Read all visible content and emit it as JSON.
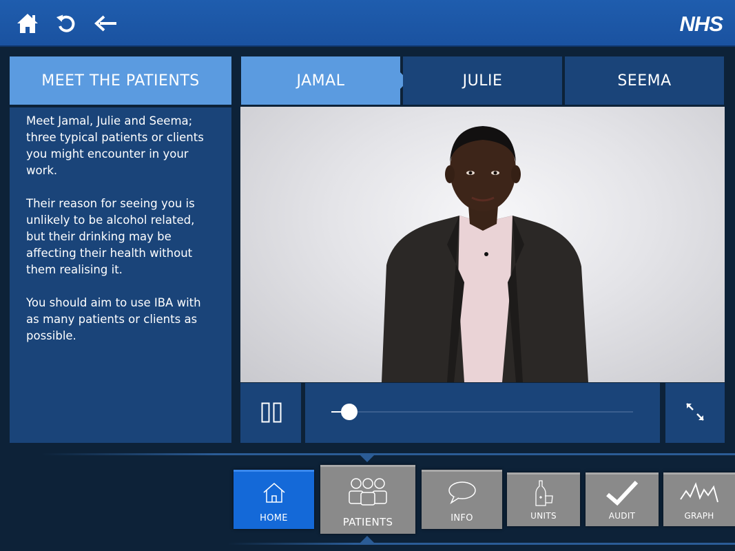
{
  "header": {
    "logo_text": "NHS",
    "icons": [
      "home-icon",
      "refresh-icon",
      "back-arrow-icon"
    ]
  },
  "side_panel": {
    "title": "MEET THE PATIENTS",
    "paragraphs": [
      "Meet Jamal, Julie and Seema; three typical patients or clients you might encounter in your work.",
      "Their reason for seeing you is unlikely to be alcohol related, but their drinking may be affecting their health without them realising it.",
      "You should aim to use IBA with as many patients or clients as possible."
    ]
  },
  "tabs": [
    {
      "label": "JAMAL",
      "active": true
    },
    {
      "label": "JULIE",
      "active": false
    },
    {
      "label": "SEEMA",
      "active": false
    }
  ],
  "player": {
    "progress": 0.06,
    "icons": [
      "pause-icon",
      "fullscreen-icon"
    ]
  },
  "dock": [
    {
      "label": "HOME",
      "icon": "house-icon",
      "color": "#1469d8"
    },
    {
      "label": "PATIENTS",
      "icon": "people-icon",
      "color": "#8a8a8a"
    },
    {
      "label": "INFO",
      "icon": "speech-bubble-icon",
      "color": "#8a8a8a"
    },
    {
      "label": "UNITS",
      "icon": "bottle-glass-icon",
      "color": "#8a8a8a"
    },
    {
      "label": "AUDIT",
      "icon": "checkmark-icon",
      "color": "#8a8a8a"
    },
    {
      "label": "GRAPH",
      "icon": "line-graph-icon",
      "color": "#8a8a8a"
    }
  ],
  "colors": {
    "brand_blue": "#1f5dae",
    "active_tab": "#5b9be0",
    "panel": "#1a4479",
    "background": "#0d2238"
  }
}
